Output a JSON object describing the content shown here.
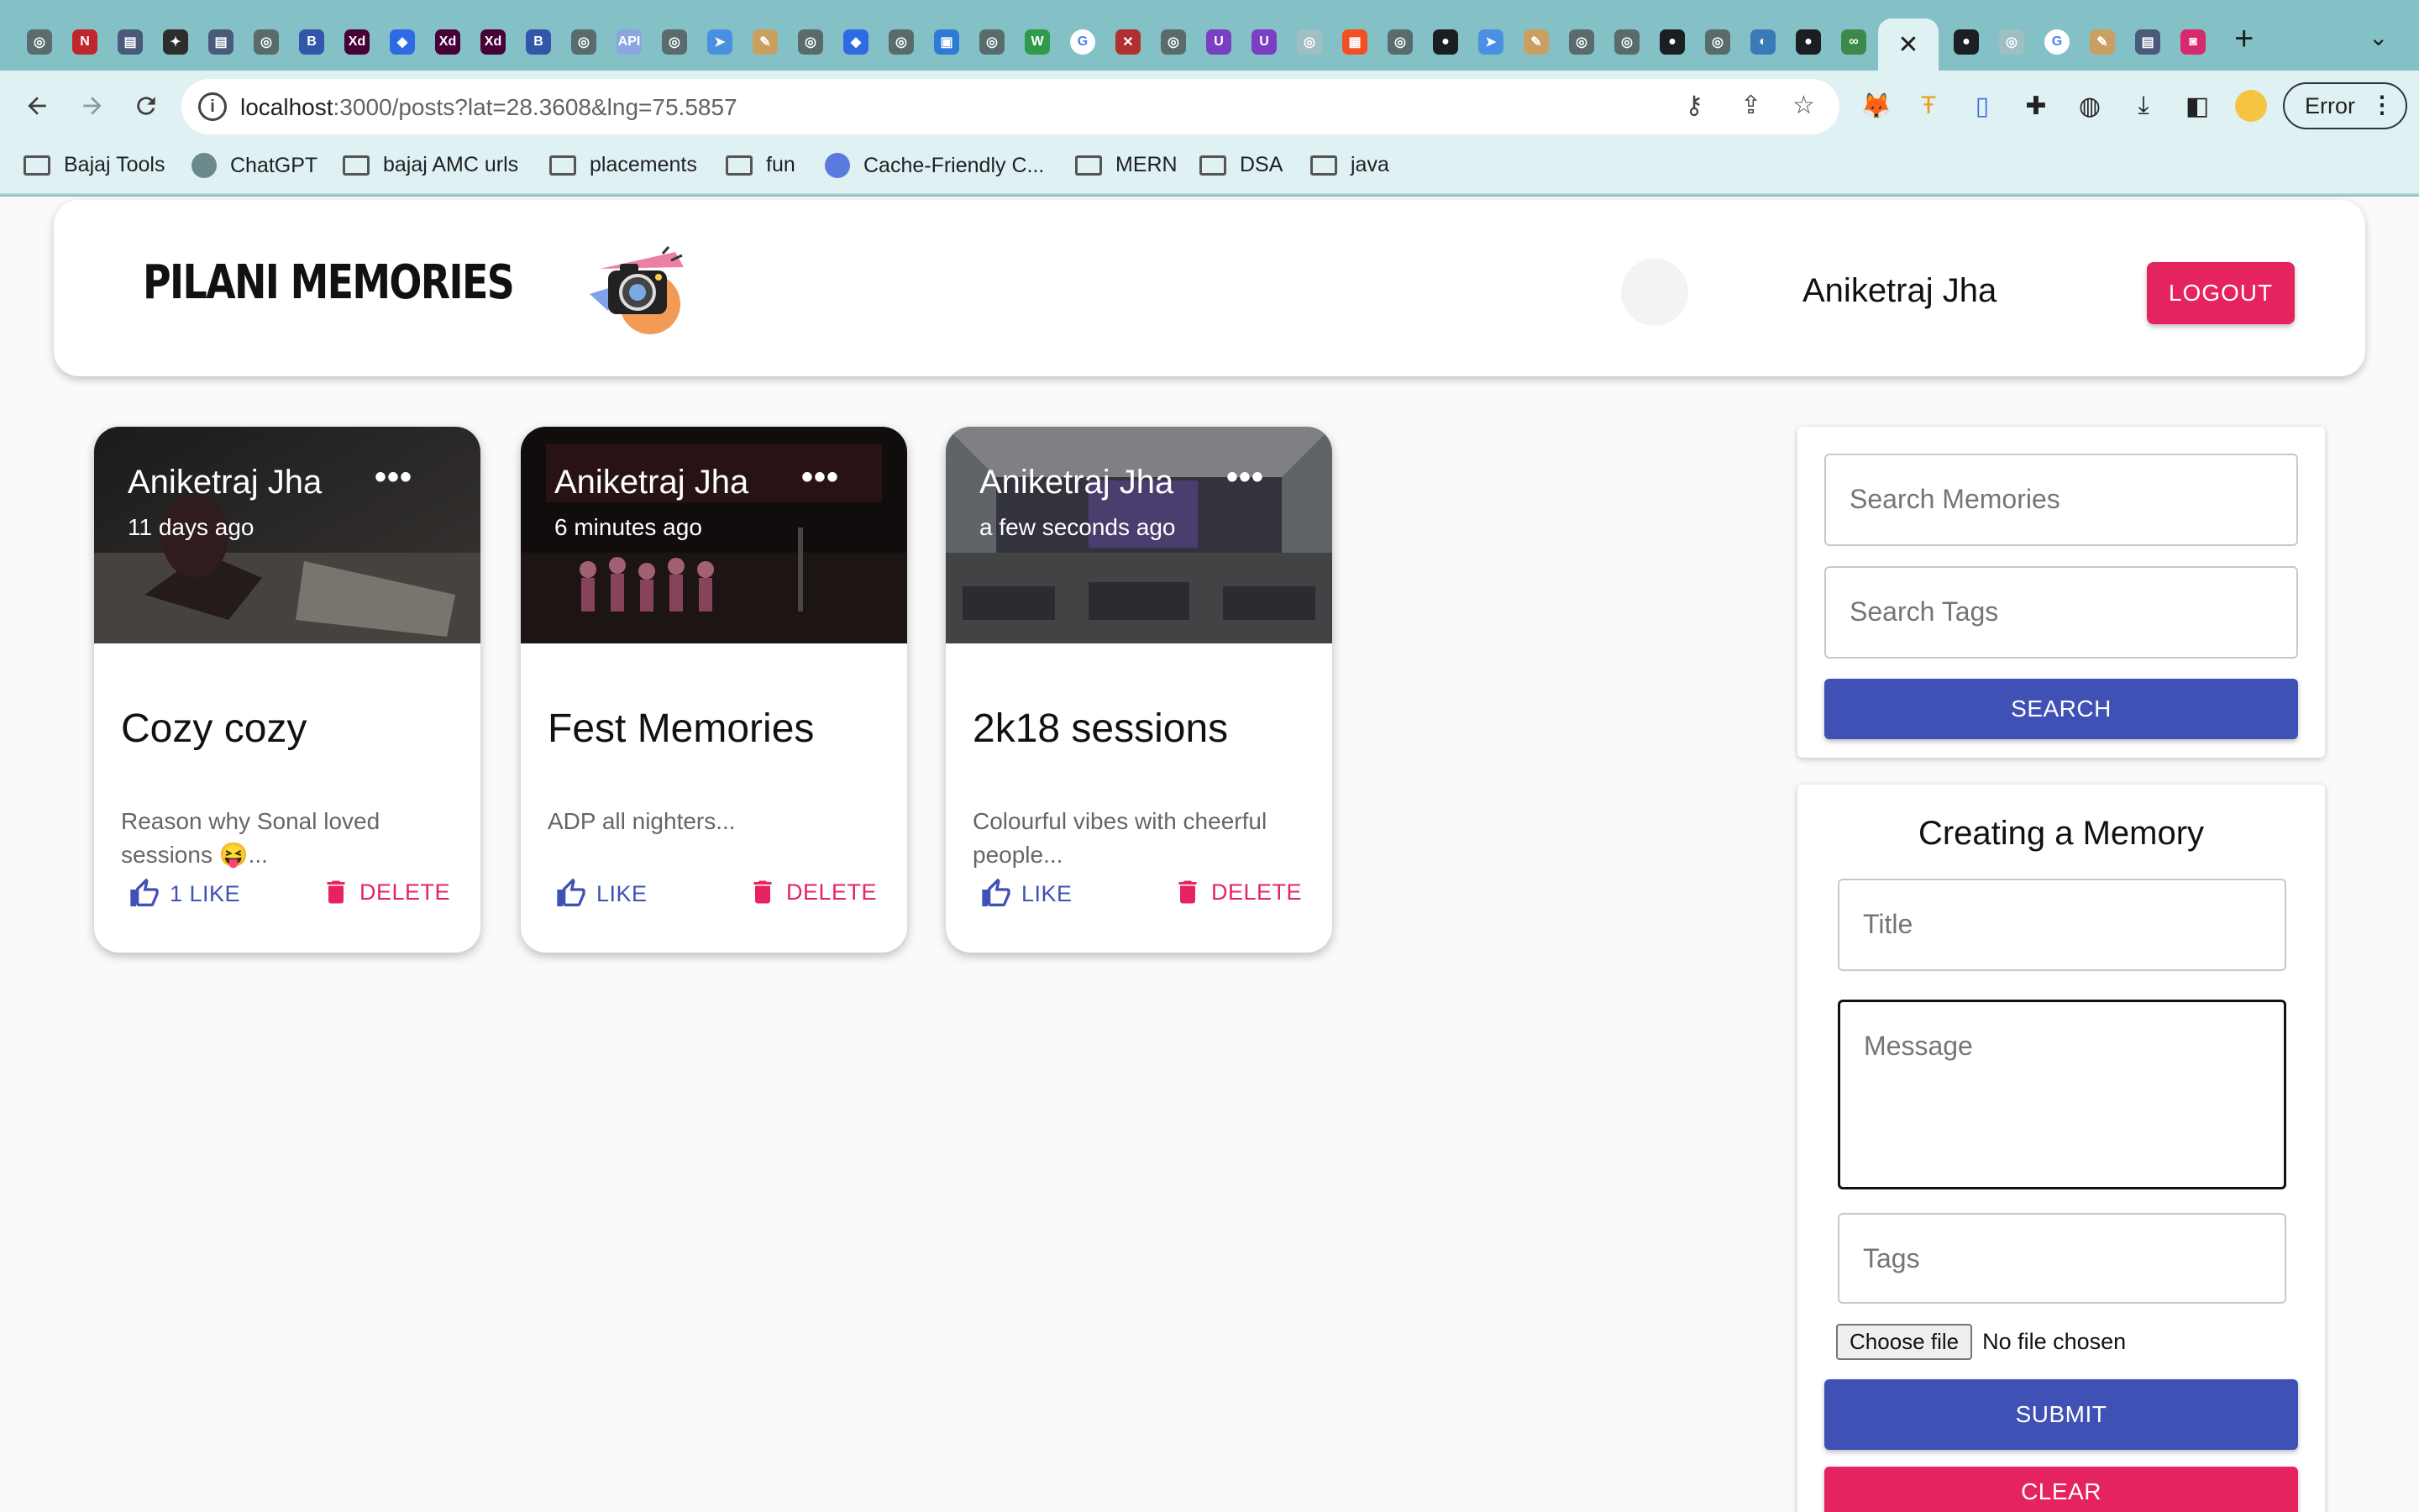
{
  "browser": {
    "tabs": [
      {
        "icon": "openai-icon",
        "color": "#5b6b6e",
        "glyph": "◎"
      },
      {
        "icon": "netflix-n-icon",
        "color": "#c0262d",
        "glyph": "N"
      },
      {
        "icon": "doc-tab-icon",
        "color": "#4a5a7a",
        "glyph": "▤"
      },
      {
        "icon": "compass-icon",
        "color": "#2d2d2d",
        "glyph": "✦"
      },
      {
        "icon": "doc-tab-icon",
        "color": "#4a5a7a",
        "glyph": "▤"
      },
      {
        "icon": "chrome-icon",
        "color": "#5a6b6d",
        "glyph": "◎"
      },
      {
        "icon": "b-icon",
        "color": "#3355aa",
        "glyph": "B"
      },
      {
        "icon": "xd-icon",
        "color": "#470137",
        "glyph": "Xd"
      },
      {
        "icon": "diamond-icon",
        "color": "#2f6ae5",
        "glyph": "◆"
      },
      {
        "icon": "xd-icon",
        "color": "#470137",
        "glyph": "Xd"
      },
      {
        "icon": "xd-icon",
        "color": "#470137",
        "glyph": "Xd"
      },
      {
        "icon": "b-icon",
        "color": "#3355aa",
        "glyph": "B"
      },
      {
        "icon": "chrome-icon",
        "color": "#5a6b6d",
        "glyph": "◎"
      },
      {
        "icon": "api-icon",
        "color": "#8aa5e0",
        "glyph": "API"
      },
      {
        "icon": "chrome-icon",
        "color": "#5a6b6d",
        "glyph": "◎"
      },
      {
        "icon": "arrow-icon",
        "color": "#4a90e2",
        "glyph": "➤"
      },
      {
        "icon": "pen-icon",
        "color": "#c9a060",
        "glyph": "✎"
      },
      {
        "icon": "chrome-icon",
        "color": "#5a6b6d",
        "glyph": "◎"
      },
      {
        "icon": "diamond-icon",
        "color": "#2f6ae5",
        "glyph": "◆"
      },
      {
        "icon": "chrome-icon",
        "color": "#5a6b6d",
        "glyph": "◎"
      },
      {
        "icon": "square-icon",
        "color": "#2e7bd6",
        "glyph": "▣"
      },
      {
        "icon": "chrome-icon",
        "color": "#5a6b6d",
        "glyph": "◎"
      },
      {
        "icon": "w-icon",
        "color": "#2e9a4a",
        "glyph": "W"
      },
      {
        "icon": "google-icon",
        "color": "#ffffff",
        "glyph": "G"
      },
      {
        "icon": "x-icon",
        "color": "#b03030",
        "glyph": "✕"
      },
      {
        "icon": "chrome-icon",
        "color": "#5a6b6d",
        "glyph": "◎"
      },
      {
        "icon": "u-icon",
        "color": "#7a3fc2",
        "glyph": "U"
      },
      {
        "icon": "u-icon",
        "color": "#7a3fc2",
        "glyph": "U"
      },
      {
        "icon": "faded-icon",
        "color": "#9fbfc2",
        "glyph": "◎"
      },
      {
        "icon": "microsoft-icon",
        "color": "#f25022",
        "glyph": "▦"
      },
      {
        "icon": "chrome-icon",
        "color": "#5a6b6d",
        "glyph": "◎"
      },
      {
        "icon": "github-icon",
        "color": "#1b1f23",
        "glyph": "●"
      },
      {
        "icon": "arrow-icon",
        "color": "#4a90e2",
        "glyph": "➤"
      },
      {
        "icon": "pen-icon",
        "color": "#c9a060",
        "glyph": "✎"
      },
      {
        "icon": "chrome-icon",
        "color": "#5a6b6d",
        "glyph": "◎"
      },
      {
        "icon": "chrome-icon",
        "color": "#5a6b6d",
        "glyph": "◎"
      },
      {
        "icon": "github-icon",
        "color": "#1b1f23",
        "glyph": "●"
      },
      {
        "icon": "chrome-icon",
        "color": "#5a6b6d",
        "glyph": "◎"
      },
      {
        "icon": "wave-icon",
        "color": "#3a7ab8",
        "glyph": "◐"
      },
      {
        "icon": "github-icon",
        "color": "#1b1f23",
        "glyph": "●"
      },
      {
        "icon": "link-icon",
        "color": "#3b8a4a",
        "glyph": "∞"
      }
    ],
    "tabs_after": [
      {
        "icon": "github-icon",
        "color": "#1b1f23",
        "glyph": "●"
      },
      {
        "icon": "faded-icon",
        "color": "#9fbfc2",
        "glyph": "◎"
      },
      {
        "icon": "google-icon",
        "color": "#ffffff",
        "glyph": "G"
      },
      {
        "icon": "pen-icon",
        "color": "#c9a060",
        "glyph": "✎"
      },
      {
        "icon": "doc-tab-icon",
        "color": "#4a5a7a",
        "glyph": "▤"
      },
      {
        "icon": "instagram-icon",
        "color": "#d6296e",
        "glyph": "◙"
      }
    ],
    "url_host": "localhost",
    "url_path": ":3000/posts?lat=28.3608&lng=75.5857",
    "error_label": "Error",
    "bookmarks": [
      {
        "label": "Bajaj Tools",
        "type": "folder"
      },
      {
        "label": "ChatGPT",
        "type": "site"
      },
      {
        "label": "bajaj AMC urls",
        "type": "folder"
      },
      {
        "label": "placements",
        "type": "folder"
      },
      {
        "label": "fun",
        "type": "folder"
      },
      {
        "label": "Cache-Friendly C...",
        "type": "site"
      },
      {
        "label": "MERN",
        "type": "folder"
      },
      {
        "label": "DSA",
        "type": "folder"
      },
      {
        "label": "java",
        "type": "folder"
      }
    ]
  },
  "header": {
    "brand": "PILANI MEMORIES",
    "user_name": "Aniketraj Jha",
    "logout_label": "LOGOUT"
  },
  "posts": [
    {
      "author": "Aniketraj Jha",
      "time": "11 days ago",
      "more": "•••",
      "title": "Cozy cozy",
      "message": "Reason why Sonal loved sessions 😝...",
      "like_label": "1 LIKE",
      "delete_label": "DELETE"
    },
    {
      "author": "Aniketraj Jha",
      "time": "6 minutes ago",
      "more": "•••",
      "title": "Fest Memories",
      "message": "ADP all nighters...",
      "like_label": "LIKE",
      "delete_label": "DELETE"
    },
    {
      "author": "Aniketraj Jha",
      "time": "a few seconds ago",
      "more": "•••",
      "title": "2k18 sessions",
      "message": "Colourful vibes with cheerful people...",
      "like_label": "LIKE",
      "delete_label": "DELETE"
    }
  ],
  "search": {
    "memories_placeholder": "Search Memories",
    "tags_placeholder": "Search Tags",
    "button_label": "SEARCH"
  },
  "form": {
    "title": "Creating a Memory",
    "title_placeholder": "Title",
    "message_placeholder": "Message",
    "tags_placeholder": "Tags",
    "file_button": "Choose file",
    "file_status": "No file chosen",
    "submit_label": "SUBMIT",
    "clear_label": "CLEAR"
  },
  "colors": {
    "chrome_bg": "#84c1c6",
    "primary": "#3f51b5",
    "secondary": "#e5245f"
  }
}
